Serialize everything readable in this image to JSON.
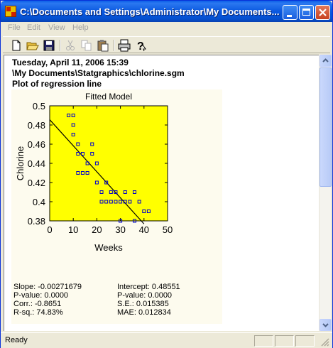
{
  "window": {
    "title": "C:\\Documents and Settings\\Administrator\\My Documents..."
  },
  "menu": [
    "File",
    "Edit",
    "View",
    "Help"
  ],
  "toolbar": {
    "icons": [
      "new-file-icon",
      "open-folder-icon",
      "save-icon",
      "cut-icon",
      "copy-icon",
      "paste-icon",
      "print-icon",
      "help-icon"
    ]
  },
  "report": {
    "date": "Tuesday, April 11, 2006 15:39",
    "path": "\\My Documents\\Statgraphics\\chlorine.sgm",
    "subtitle": "Plot of regression line"
  },
  "chart_data": {
    "type": "scatter",
    "title": "Fitted Model",
    "xlabel": "Weeks",
    "ylabel": "Chlorine",
    "xlim": [
      0,
      50
    ],
    "ylim": [
      0.38,
      0.5
    ],
    "xticks": [
      0,
      10,
      20,
      30,
      40,
      50
    ],
    "yticks": [
      0.38,
      0.4,
      0.42,
      0.44,
      0.46,
      0.48,
      0.5
    ],
    "ytick_labels": [
      "0.38",
      "0.4",
      "0.42",
      "0.44",
      "0.46",
      "0.48",
      "0.5"
    ],
    "background": "#ffff00",
    "marker_color": "#0000cc",
    "line": {
      "intercept": 0.48551,
      "slope": -0.00271679,
      "x_range": [
        0,
        40
      ]
    },
    "points": [
      [
        8,
        0.49
      ],
      [
        10,
        0.47
      ],
      [
        10,
        0.48
      ],
      [
        10,
        0.49
      ],
      [
        12,
        0.45
      ],
      [
        12,
        0.46
      ],
      [
        12,
        0.43
      ],
      [
        14,
        0.45
      ],
      [
        14,
        0.43
      ],
      [
        16,
        0.44
      ],
      [
        16,
        0.43
      ],
      [
        18,
        0.46
      ],
      [
        18,
        0.45
      ],
      [
        20,
        0.42
      ],
      [
        20,
        0.44
      ],
      [
        22,
        0.4
      ],
      [
        22,
        0.41
      ],
      [
        24,
        0.4
      ],
      [
        24,
        0.42
      ],
      [
        26,
        0.4
      ],
      [
        26,
        0.41
      ],
      [
        28,
        0.41
      ],
      [
        28,
        0.4
      ],
      [
        30,
        0.4
      ],
      [
        30,
        0.38
      ],
      [
        32,
        0.4
      ],
      [
        32,
        0.41
      ],
      [
        34,
        0.4
      ],
      [
        36,
        0.41
      ],
      [
        36,
        0.38
      ],
      [
        38,
        0.4
      ],
      [
        40,
        0.39
      ],
      [
        42,
        0.39
      ]
    ]
  },
  "stats": {
    "slope": "Slope: -0.00271679",
    "p_value_left": "P-value: 0.0000",
    "corr": "Corr.: -0.8651",
    "rsq": "R-sq.: 74.83%",
    "intercept": "Intercept: 0.48551",
    "p_value_right": "P-value: 0.0000",
    "se": "S.E.: 0.015385",
    "mae": "MAE: 0.012834"
  },
  "status": {
    "text": "Ready"
  }
}
